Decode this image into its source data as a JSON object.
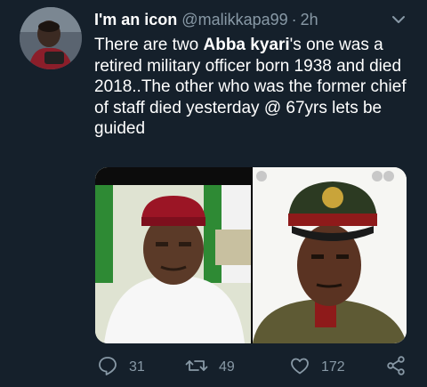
{
  "tweet": {
    "display_name": "I'm an icon",
    "handle": "@malikkapa99",
    "separator": "·",
    "time": "2h",
    "text": {
      "part1": "There are two ",
      "bold": "Abba kyari",
      "part2": "'s one was a retired military officer born 1938 and died 2018..The other  who was the former chief of staff died yesterday @ 67yrs lets be guided"
    },
    "media": {
      "left_image": "photo-man-red-cap",
      "right_image": "illustration-military-officer"
    }
  },
  "actions": {
    "reply_count": "31",
    "retweet_count": "49",
    "like_count": "172"
  },
  "icons": {
    "reply": "reply-icon",
    "retweet": "retweet-icon",
    "like": "heart-icon",
    "share": "share-icon",
    "more": "chevron-down-icon"
  },
  "colors": {
    "background": "#15202b",
    "secondary_text": "#8899a6",
    "primary_text": "#ffffff"
  }
}
